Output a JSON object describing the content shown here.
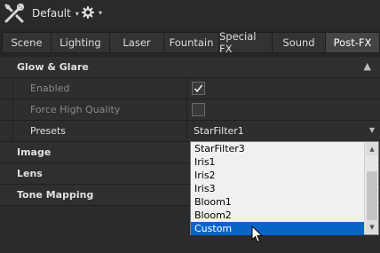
{
  "topbar": {
    "logo_icon": "tools-icon",
    "preset_label": "Default",
    "preset_caret": "▾",
    "settings_icon": "gear-icon",
    "settings_caret": "▾"
  },
  "tabs": [
    {
      "label": "Scene",
      "active": false
    },
    {
      "label": "Lighting",
      "active": false
    },
    {
      "label": "Laser",
      "active": false
    },
    {
      "label": "Fountain",
      "active": false
    },
    {
      "label": "Special FX",
      "active": false
    },
    {
      "label": "Sound",
      "active": false
    },
    {
      "label": "Post-FX",
      "active": true
    }
  ],
  "sections": {
    "glow": {
      "label": "Glow & Glare",
      "collapse_glyph": "▲",
      "enabled_label": "Enabled",
      "enabled_checked": true,
      "force_label": "Force High Quality",
      "force_checked": false,
      "presets_label": "Presets",
      "presets_value": "StarFilter1",
      "presets_arrow": "▼"
    },
    "image": {
      "label": "Image"
    },
    "lens": {
      "label": "Lens"
    },
    "tone": {
      "label": "Tone Mapping"
    }
  },
  "dropdown": {
    "options": [
      "StarFilter3",
      "Iris1",
      "Iris2",
      "Iris3",
      "Bloom1",
      "Bloom2",
      "Custom"
    ],
    "selected_index": 6,
    "scroll_up": "▲",
    "scroll_down": "▼"
  },
  "colors": {
    "selection": "#0a64c8",
    "background": "#262626",
    "panel": "#2b2b2b"
  }
}
